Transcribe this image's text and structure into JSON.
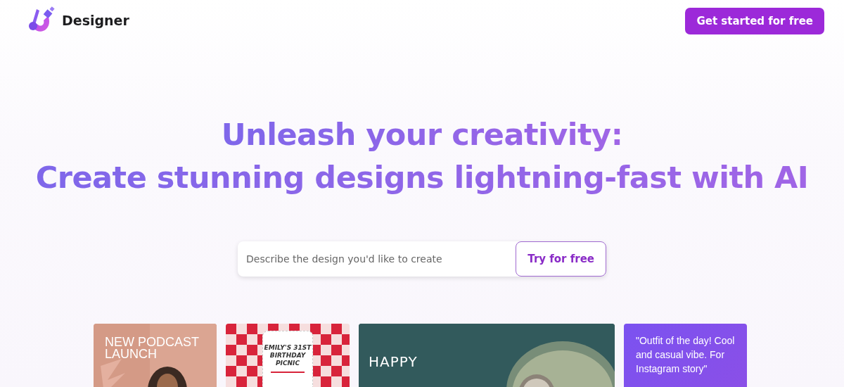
{
  "header": {
    "logo_text": "Designer",
    "cta": "Get started for free"
  },
  "hero": {
    "lines": [
      "Unleash your creativity:",
      "Create stunning designs lightning-fast with AI"
    ]
  },
  "prompt": {
    "placeholder": "Describe the design you'd like to create",
    "button": "Try for free"
  },
  "cards": [
    {
      "kind": "podcast",
      "texts": [
        "NEW PODCAST",
        "LAUNCH"
      ]
    },
    {
      "kind": "picnic",
      "texts": [
        "EMILY'S 31ST",
        "BIRTHDAY",
        "PICNIC"
      ]
    },
    {
      "kind": "birthday",
      "texts": [
        "HAPPY"
      ]
    },
    {
      "kind": "quote",
      "texts": [
        "\"Outfit of the day! Cool and casual vibe. For Instagram story\""
      ]
    }
  ]
}
